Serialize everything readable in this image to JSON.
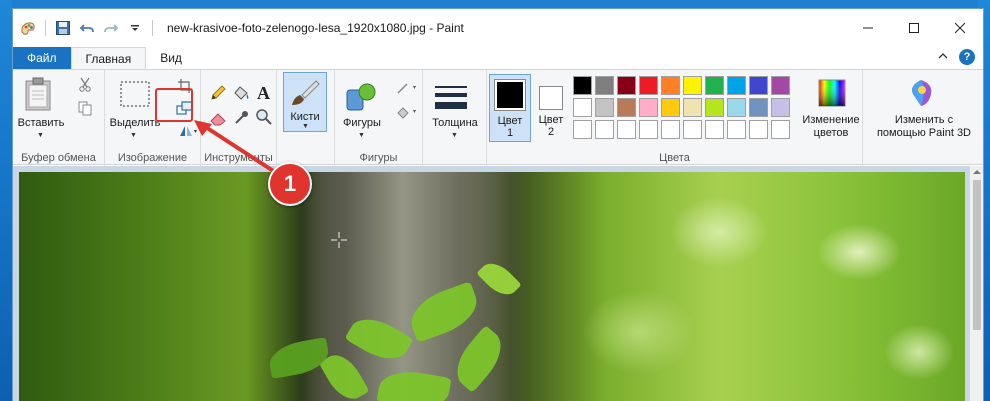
{
  "window": {
    "title": "new-krasivoe-foto-zelenogo-lesa_1920x1080.jpg - Paint"
  },
  "tabs": {
    "file": "Файл",
    "home": "Главная",
    "view": "Вид"
  },
  "ribbon": {
    "clipboard": {
      "paste": "Вставить",
      "group": "Буфер обмена"
    },
    "image": {
      "select": "Выделить",
      "group": "Изображение"
    },
    "tools": {
      "group": "Инструменты"
    },
    "brushes": {
      "label": "Кисти"
    },
    "shapes": {
      "label": "Фигуры",
      "group": "Фигуры"
    },
    "size": {
      "label": "Толщина"
    },
    "colors": {
      "color1_line1": "Цвет",
      "color1_line2": "1",
      "color2_line1": "Цвет",
      "color2_line2": "2",
      "edit_line1": "Изменение",
      "edit_line2": "цветов",
      "group": "Цвета",
      "color1_value": "#000000",
      "color2_value": "#ffffff",
      "palette_row1": [
        "#000000",
        "#7f7f7f",
        "#880015",
        "#ed1c24",
        "#ff7f27",
        "#fff200",
        "#22b14c",
        "#00a2e8",
        "#3f48cc",
        "#a349a4"
      ],
      "palette_row2": [
        "#ffffff",
        "#c3c3c3",
        "#b97a57",
        "#ffaec9",
        "#ffc90e",
        "#efe4b0",
        "#b5e61d",
        "#99d9ea",
        "#7092be",
        "#c8bfe7"
      ],
      "palette_row3": [
        "#ffffff",
        "#ffffff",
        "#ffffff",
        "#ffffff",
        "#ffffff",
        "#ffffff",
        "#ffffff",
        "#ffffff",
        "#ffffff",
        "#ffffff"
      ]
    },
    "paint3d": {
      "line1": "Изменить с",
      "line2": "помощью Paint 3D"
    }
  },
  "annotation": {
    "badge": "1",
    "color": "#e0352f"
  }
}
